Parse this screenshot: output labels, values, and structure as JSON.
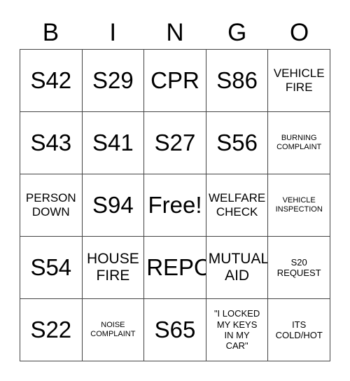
{
  "header": {
    "letters": [
      "B",
      "I",
      "N",
      "G",
      "O"
    ]
  },
  "grid": {
    "rows": 5,
    "columns": 5,
    "border_color": "#444444",
    "background_color": "#ffffff",
    "text_color": "#000000",
    "cells": [
      {
        "text": "S42",
        "size": "size-xl"
      },
      {
        "text": "S29",
        "size": "size-xl"
      },
      {
        "text": "CPR",
        "size": "size-xl"
      },
      {
        "text": "S86",
        "size": "size-xl"
      },
      {
        "text": "VEHICLE\nFIRE",
        "size": "size-md"
      },
      {
        "text": "S43",
        "size": "size-xl"
      },
      {
        "text": "S41",
        "size": "size-xl"
      },
      {
        "text": "S27",
        "size": "size-xl"
      },
      {
        "text": "S56",
        "size": "size-xl"
      },
      {
        "text": "BURNING\nCOMPLAINT",
        "size": "size-xs"
      },
      {
        "text": "PERSON\nDOWN",
        "size": "size-md"
      },
      {
        "text": "S94",
        "size": "size-xl"
      },
      {
        "text": "Free!",
        "size": "size-xl"
      },
      {
        "text": "WELFARE\nCHECK",
        "size": "size-md"
      },
      {
        "text": "VEHICLE\nINSPECTION",
        "size": "size-xs"
      },
      {
        "text": "S54",
        "size": "size-xl"
      },
      {
        "text": "HOUSE\nFIRE",
        "size": "size-lg"
      },
      {
        "text": "REPO",
        "size": "size-xl"
      },
      {
        "text": "MUTUAL\nAID",
        "size": "size-lg"
      },
      {
        "text": "S20\nREQUEST",
        "size": "size-sm"
      },
      {
        "text": "S22",
        "size": "size-xl"
      },
      {
        "text": "NOISE\nCOMPLAINT",
        "size": "size-xs"
      },
      {
        "text": "S65",
        "size": "size-xl"
      },
      {
        "text": "\"I LOCKED\nMY KEYS\nIN MY\nCAR\"",
        "size": "size-sm"
      },
      {
        "text": "ITS\nCOLD/HOT",
        "size": "size-sm"
      }
    ]
  }
}
